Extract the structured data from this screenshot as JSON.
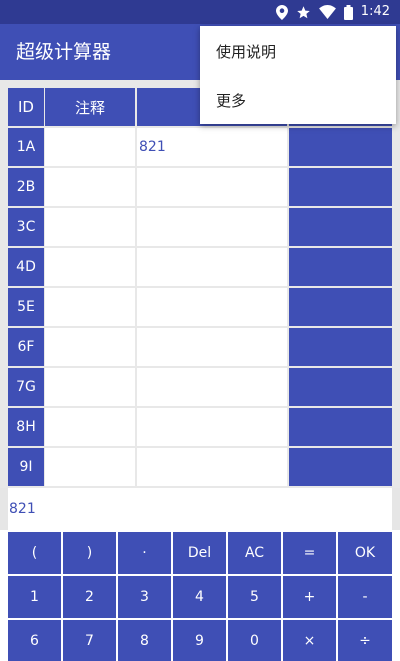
{
  "status_bar": {
    "time": "1:42",
    "icons": [
      "location-icon",
      "star-icon",
      "wifi-icon",
      "battery-icon"
    ]
  },
  "app_bar": {
    "title": "超级计算器"
  },
  "table": {
    "headers": [
      "ID",
      "注释",
      "",
      ""
    ],
    "rows": [
      {
        "id": "1A",
        "note": "",
        "expr": "821"
      },
      {
        "id": "2B",
        "note": "",
        "expr": ""
      },
      {
        "id": "3C",
        "note": "",
        "expr": ""
      },
      {
        "id": "4D",
        "note": "",
        "expr": ""
      },
      {
        "id": "5E",
        "note": "",
        "expr": ""
      },
      {
        "id": "6F",
        "note": "",
        "expr": ""
      },
      {
        "id": "7G",
        "note": "",
        "expr": ""
      },
      {
        "id": "8H",
        "note": "",
        "expr": ""
      },
      {
        "id": "9I",
        "note": "",
        "expr": ""
      }
    ]
  },
  "result": {
    "text": "821"
  },
  "keypad": {
    "rows": [
      [
        "(",
        ")",
        "·",
        "Del",
        "AC",
        "=",
        "OK"
      ],
      [
        "1",
        "2",
        "3",
        "4",
        "5",
        "+",
        "-"
      ],
      [
        "6",
        "7",
        "8",
        "9",
        "0",
        "×",
        "÷"
      ]
    ]
  },
  "overflow_menu": {
    "items": [
      "使用说明",
      "更多"
    ]
  },
  "colors": {
    "primary": "#3f4fb5",
    "primary_dark": "#2f3a92",
    "surface": "#ffffff",
    "grid_gap": "#e8e8e8"
  }
}
